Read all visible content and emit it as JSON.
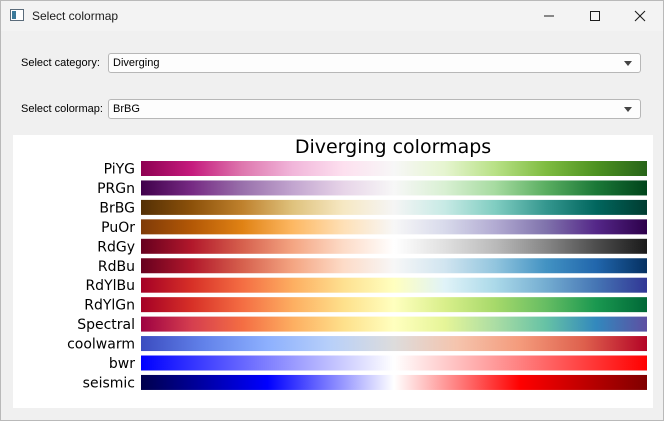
{
  "window": {
    "title": "Select colormap"
  },
  "controls": {
    "category_label": "Select category:",
    "category_value": "Diverging",
    "colormap_label": "Select colormap:",
    "colormap_value": "BrBG"
  },
  "figure": {
    "title": "Diverging colormaps",
    "colormaps": [
      {
        "name": "PiYG",
        "stops": [
          "#8e0152",
          "#c51b7d",
          "#de77ae",
          "#f1b6da",
          "#fde0ef",
          "#f7f7f7",
          "#e6f5d0",
          "#b8e186",
          "#7fbc41",
          "#4d9221",
          "#276419"
        ]
      },
      {
        "name": "PRGn",
        "stops": [
          "#40004b",
          "#762a83",
          "#9970ab",
          "#c2a5cf",
          "#e7d4e8",
          "#f7f7f7",
          "#d9f0d3",
          "#a6dba0",
          "#5aae61",
          "#1b7837",
          "#00441b"
        ]
      },
      {
        "name": "BrBG",
        "stops": [
          "#543005",
          "#8c510a",
          "#bf812d",
          "#dfc27d",
          "#f6e8c3",
          "#f5f5f5",
          "#c7eae5",
          "#80cdc1",
          "#35978f",
          "#01665e",
          "#003c30"
        ]
      },
      {
        "name": "PuOr",
        "stops": [
          "#7f3b08",
          "#b35806",
          "#e08214",
          "#fdb863",
          "#fee0b6",
          "#f7f7f7",
          "#d8daeb",
          "#b2abd2",
          "#8073ac",
          "#542788",
          "#2d004b"
        ]
      },
      {
        "name": "RdGy",
        "stops": [
          "#67001f",
          "#b2182b",
          "#d6604d",
          "#f4a582",
          "#fddbc7",
          "#ffffff",
          "#e0e0e0",
          "#bababa",
          "#878787",
          "#4d4d4d",
          "#1a1a1a"
        ]
      },
      {
        "name": "RdBu",
        "stops": [
          "#67001f",
          "#b2182b",
          "#d6604d",
          "#f4a582",
          "#fddbc7",
          "#f7f7f7",
          "#d1e5f0",
          "#92c5de",
          "#4393c3",
          "#2166ac",
          "#053061"
        ]
      },
      {
        "name": "RdYlBu",
        "stops": [
          "#a50026",
          "#d73027",
          "#f46d43",
          "#fdae61",
          "#fee090",
          "#ffffbf",
          "#e0f3f8",
          "#abd9e9",
          "#74add1",
          "#4575b4",
          "#313695"
        ]
      },
      {
        "name": "RdYlGn",
        "stops": [
          "#a50026",
          "#d73027",
          "#f46d43",
          "#fdae61",
          "#fee08b",
          "#ffffbf",
          "#d9ef8b",
          "#a6d96a",
          "#66bd63",
          "#1a9850",
          "#006837"
        ]
      },
      {
        "name": "Spectral",
        "stops": [
          "#9e0142",
          "#d53e4f",
          "#f46d43",
          "#fdae61",
          "#fee08b",
          "#ffffbf",
          "#e6f598",
          "#abdda4",
          "#66c2a5",
          "#3288bd",
          "#5e4fa2"
        ]
      },
      {
        "name": "coolwarm",
        "stops": [
          "#3b4cc0",
          "#6282ea",
          "#8db0fe",
          "#b8d0f9",
          "#dddcdc",
          "#f5c4ad",
          "#f49a7b",
          "#de604d",
          "#b40426"
        ]
      },
      {
        "name": "bwr",
        "stops": [
          "#0000ff",
          "#ffffff",
          "#ff0000"
        ]
      },
      {
        "name": "seismic",
        "stops": [
          "#00004c",
          "#0000ff",
          "#ffffff",
          "#ff0000",
          "#800000"
        ]
      }
    ]
  }
}
